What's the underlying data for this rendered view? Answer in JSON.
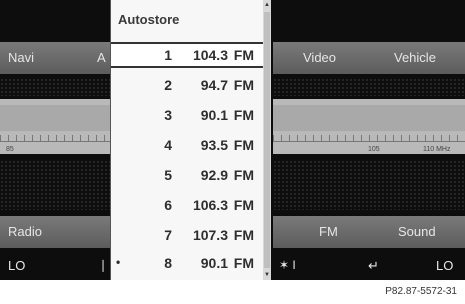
{
  "tabs_left": {
    "navi": "Navi",
    "partial": "A"
  },
  "tabs_right": {
    "video": "Video",
    "vehicle": "Vehicle"
  },
  "scale_labels": {
    "left": "85",
    "mid": "105",
    "right": "110 MHz"
  },
  "bottom_menu": {
    "radio": "Radio",
    "fm": "FM",
    "sound": "Sound"
  },
  "status_bar": {
    "left_temp": "LO",
    "right_temp": "LO",
    "fan_label": "✶ I"
  },
  "popup": {
    "title": "Autostore",
    "stations": [
      {
        "num": "1",
        "freq": "104.3",
        "band": "FM",
        "bullet": "",
        "selected": true
      },
      {
        "num": "2",
        "freq": "94.7",
        "band": "FM",
        "bullet": "",
        "selected": false
      },
      {
        "num": "3",
        "freq": "90.1",
        "band": "FM",
        "bullet": "",
        "selected": false
      },
      {
        "num": "4",
        "freq": "93.5",
        "band": "FM",
        "bullet": "",
        "selected": false
      },
      {
        "num": "5",
        "freq": "92.9",
        "band": "FM",
        "bullet": "",
        "selected": false
      },
      {
        "num": "6",
        "freq": "106.3",
        "band": "FM",
        "bullet": "",
        "selected": false
      },
      {
        "num": "7",
        "freq": "107.3",
        "band": "FM",
        "bullet": "",
        "selected": false
      },
      {
        "num": "8",
        "freq": "90.1",
        "band": "FM",
        "bullet": "•",
        "selected": false
      }
    ]
  },
  "figure_ref": "P82.87-5572-31",
  "colors": {
    "screen_bg": "#0d0d0d",
    "popup_bg": "#f7f7f7",
    "bar_bg": "#6a6a6a"
  }
}
